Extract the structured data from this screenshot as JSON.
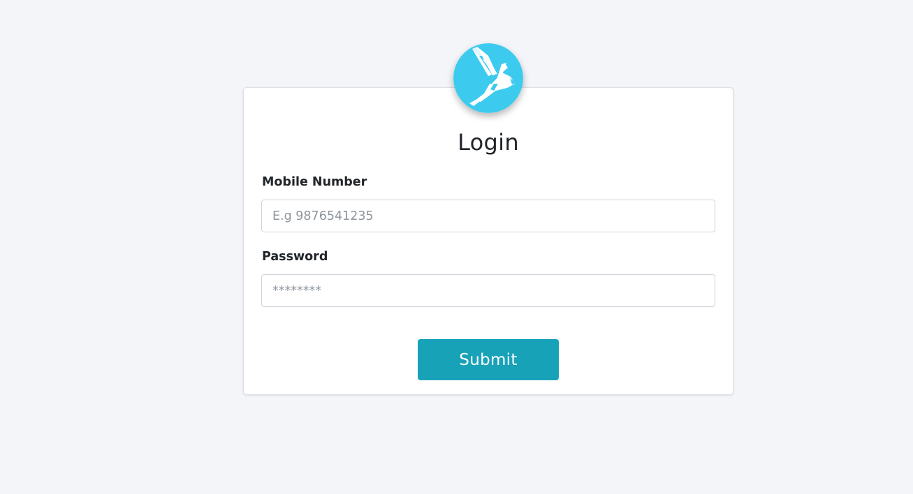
{
  "login": {
    "title": "Login",
    "mobile_label": "Mobile Number",
    "mobile_placeholder": "E.g 9876541235",
    "password_label": "Password",
    "password_placeholder": "********",
    "submit_label": "Submit"
  },
  "logo": {
    "icon": "eagle-logo-icon",
    "background_color": "#3ccbef",
    "foreground_color": "#ffffff"
  },
  "colors": {
    "page_background": "#f4f5f9",
    "card_background": "#ffffff",
    "submit_button": "#17a2b8",
    "text": "#212529"
  }
}
